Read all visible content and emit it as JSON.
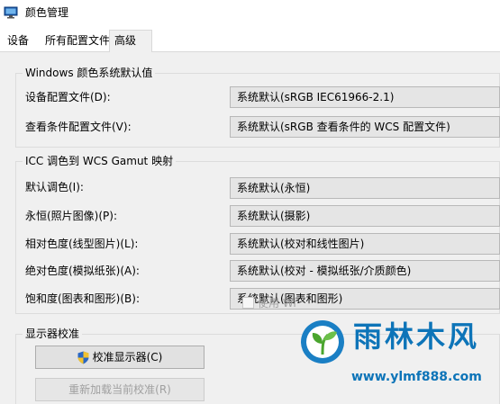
{
  "window": {
    "title": "颜色管理",
    "app_icon": "monitor-icon"
  },
  "tabs": [
    {
      "label": "设备",
      "active": false
    },
    {
      "label": "所有配置文件",
      "active": false
    },
    {
      "label": "高级",
      "active": true
    }
  ],
  "windows_defaults": {
    "title": "Windows 颜色系统默认值",
    "rows": [
      {
        "label": "设备配置文件(D):",
        "value": "系统默认(sRGB IEC61966-2.1)"
      },
      {
        "label": "查看条件配置文件(V):",
        "value": "系统默认(sRGB 查看条件的 WCS 配置文件)"
      }
    ]
  },
  "icc_mapping": {
    "title": "ICC 调色到 WCS Gamut 映射",
    "rows": [
      {
        "label": "默认调色(I):",
        "value": "系统默认(永恒)"
      },
      {
        "label": "永恒(照片图像)(P):",
        "value": "系统默认(摄影)"
      },
      {
        "label": "相对色度(线型图片)(L):",
        "value": "系统默认(校对和线性图片)"
      },
      {
        "label": "绝对色度(模拟纸张)(A):",
        "value": "系统默认(校对 - 模拟纸张/介质颜色)"
      },
      {
        "label": "饱和度(图表和图形)(B):",
        "value": "系统默认(图表和图形)"
      }
    ]
  },
  "calibration": {
    "title": "显示器校准",
    "calibrate_button": "校准显示器(C)",
    "calibrate_icon": "uac-shield-icon",
    "reload_button": "重新加载当前校准(R)",
    "checkbox_label": "使用 Wi",
    "checkbox_checked": false
  },
  "watermark": {
    "logo_icon": "ylmf-leaf-logo",
    "text": "雨林木风",
    "url": "www.ylmf888.com",
    "color": "#0d74b8"
  }
}
